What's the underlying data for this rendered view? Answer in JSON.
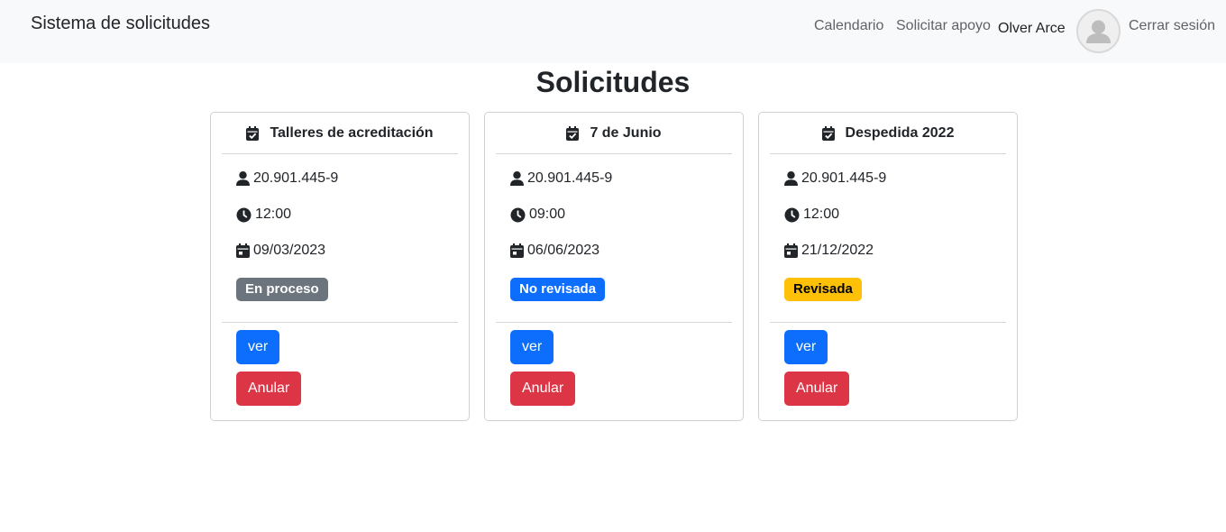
{
  "navbar": {
    "brand": "Sistema de solicitudes",
    "links": {
      "calendar": "Calendario",
      "support": "Solicitar apoyo",
      "logout": "Cerrar sesión"
    },
    "user_name": "Olver Arce"
  },
  "page": {
    "title": "Solicitudes"
  },
  "cards": [
    {
      "title": "Talleres de acreditación",
      "requester": "20.901.445-9",
      "time": "12:00",
      "date": "09/03/2023",
      "status": "En proceso",
      "status_color": "#6c757d",
      "view_label": "ver",
      "cancel_label": "Anular"
    },
    {
      "title": "7 de Junio",
      "requester": "20.901.445-9",
      "time": "09:00",
      "date": "06/06/2023",
      "status": "No revisada",
      "status_color": "#0d6efd",
      "view_label": "ver",
      "cancel_label": "Anular"
    },
    {
      "title": "Despedida 2022",
      "requester": "20.901.445-9",
      "time": "12:00",
      "date": "21/12/2022",
      "status": "Revisada",
      "status_color": "#ffc107",
      "view_label": "ver",
      "cancel_label": "Anular"
    }
  ],
  "colors": {
    "primary": "#0d6efd",
    "danger": "#dc3545",
    "secondary": "#6c757d",
    "warning": "#ffc107",
    "navbar_bg": "#f8f9fa"
  },
  "icons": {
    "card_header": "calendar-check-icon",
    "requester": "user-icon",
    "time": "clock-icon",
    "date": "calendar-icon",
    "avatar": "user-avatar-icon"
  }
}
